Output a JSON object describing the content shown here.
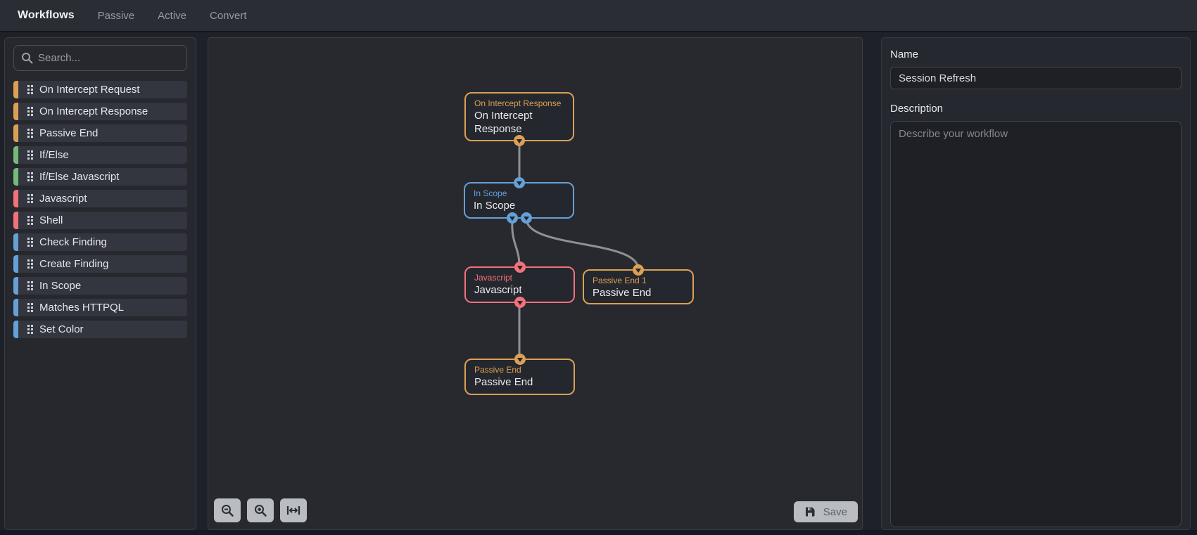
{
  "topbar": {
    "title": "Workflows",
    "tabs": [
      {
        "label": "Passive"
      },
      {
        "label": "Active"
      },
      {
        "label": "Convert"
      }
    ]
  },
  "sidebar": {
    "search_placeholder": "Search...",
    "items": [
      {
        "label": "On Intercept Request",
        "color": "#dba054"
      },
      {
        "label": "On Intercept Response",
        "color": "#dba054"
      },
      {
        "label": "Passive End",
        "color": "#dba054"
      },
      {
        "label": "If/Else",
        "color": "#74ba79"
      },
      {
        "label": "If/Else Javascript",
        "color": "#74ba79"
      },
      {
        "label": "Javascript",
        "color": "#f2717a"
      },
      {
        "label": "Shell",
        "color": "#f2717a"
      },
      {
        "label": "Check Finding",
        "color": "#65a0d8"
      },
      {
        "label": "Create Finding",
        "color": "#65a0d8"
      },
      {
        "label": "In Scope",
        "color": "#65a0d8"
      },
      {
        "label": "Matches HTTPQL",
        "color": "#65a0d8"
      },
      {
        "label": "Set Color",
        "color": "#65a0d8"
      }
    ]
  },
  "canvas": {
    "nodes": [
      {
        "title": "On Intercept Response",
        "label": "On Intercept Response",
        "color": "#dba054",
        "color_name": "orange"
      },
      {
        "title": "In Scope",
        "label": "In Scope",
        "color": "#65a0d8",
        "color_name": "blue"
      },
      {
        "title": "Javascript",
        "label": "Javascript",
        "color": "#f2717a",
        "color_name": "red"
      },
      {
        "title": "Passive End 1",
        "label": "Passive End",
        "color": "#dba054",
        "color_name": "orange"
      },
      {
        "title": "Passive End",
        "label": "Passive End",
        "color": "#dba054",
        "color_name": "orange"
      }
    ],
    "edges": [
      {
        "from": "On Intercept Response",
        "to": "In Scope"
      },
      {
        "from": "In Scope",
        "to": "Javascript"
      },
      {
        "from": "In Scope",
        "to": "Passive End 1"
      },
      {
        "from": "Javascript",
        "to": "Passive End"
      }
    ],
    "save_label": "Save"
  },
  "inspector": {
    "name_label": "Name",
    "name_value": "Session Refresh",
    "description_label": "Description",
    "description_placeholder": "Describe your workflow"
  },
  "colors": {
    "accent_orange": "#dba054",
    "accent_green": "#74ba79",
    "accent_red": "#f2717a",
    "accent_blue": "#65a0d8",
    "edge": "#8e9093",
    "button": "#b9bcc2"
  }
}
